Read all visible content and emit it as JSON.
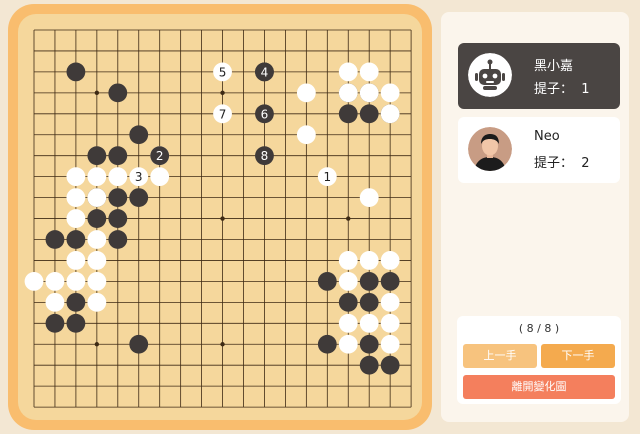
{
  "board": {
    "size": 19,
    "line_color": "#3e2a14",
    "board_color": "#f5d79c",
    "frame_color": "#f9bd6e",
    "black_stone_color": "#3f3a39",
    "white_stone_color": "#ffffff",
    "star_points": [
      [
        3,
        3
      ],
      [
        9,
        3
      ],
      [
        15,
        3
      ],
      [
        3,
        9
      ],
      [
        9,
        9
      ],
      [
        15,
        9
      ],
      [
        3,
        15
      ],
      [
        9,
        15
      ],
      [
        15,
        15
      ]
    ],
    "black_stones": [
      [
        2,
        2
      ],
      [
        4,
        3
      ],
      [
        5,
        5
      ],
      [
        3,
        6
      ],
      [
        4,
        6
      ],
      [
        3,
        8
      ],
      [
        4,
        8
      ],
      [
        5,
        8
      ],
      [
        3,
        9
      ],
      [
        4,
        9
      ],
      [
        1,
        10
      ],
      [
        2,
        10
      ],
      [
        4,
        10
      ],
      [
        2,
        13
      ],
      [
        2,
        14
      ],
      [
        1,
        14
      ],
      [
        5,
        15
      ],
      [
        11,
        2
      ],
      [
        15,
        3
      ],
      [
        16,
        3
      ],
      [
        16,
        4
      ],
      [
        17,
        4
      ],
      [
        15,
        4
      ],
      [
        14,
        12
      ],
      [
        16,
        12
      ],
      [
        17,
        12
      ],
      [
        15,
        13
      ],
      [
        16,
        13
      ],
      [
        14,
        15
      ],
      [
        16,
        15
      ],
      [
        16,
        16
      ],
      [
        17,
        16
      ]
    ],
    "white_stones": [
      [
        2,
        7
      ],
      [
        3,
        7
      ],
      [
        4,
        7
      ],
      [
        6,
        7
      ],
      [
        3,
        8
      ],
      [
        6,
        6
      ],
      [
        2,
        8
      ],
      [
        2,
        9
      ],
      [
        3,
        10
      ],
      [
        2,
        11
      ],
      [
        1,
        12
      ],
      [
        0,
        12
      ],
      [
        3,
        11
      ],
      [
        2,
        12
      ],
      [
        3,
        12
      ],
      [
        1,
        13
      ],
      [
        3,
        13
      ],
      [
        13,
        3
      ],
      [
        15,
        3
      ],
      [
        16,
        3
      ],
      [
        17,
        3
      ],
      [
        17,
        4
      ],
      [
        16,
        2
      ],
      [
        15,
        2
      ],
      [
        13,
        5
      ],
      [
        16,
        8
      ],
      [
        15,
        11
      ],
      [
        16,
        11
      ],
      [
        17,
        11
      ],
      [
        15,
        12
      ],
      [
        17,
        13
      ],
      [
        16,
        14
      ],
      [
        17,
        14
      ],
      [
        15,
        14
      ],
      [
        15,
        15
      ],
      [
        17,
        15
      ]
    ],
    "numbered_moves": [
      {
        "num": "1",
        "color": "white",
        "x": 14,
        "y": 7
      },
      {
        "num": "2",
        "color": "black",
        "x": 6,
        "y": 6
      },
      {
        "num": "3",
        "color": "white",
        "x": 5,
        "y": 7
      },
      {
        "num": "4",
        "color": "black",
        "x": 11,
        "y": 2
      },
      {
        "num": "5",
        "color": "white",
        "x": 9,
        "y": 2
      },
      {
        "num": "6",
        "color": "black",
        "x": 11,
        "y": 4
      },
      {
        "num": "7",
        "color": "white",
        "x": 9,
        "y": 4
      },
      {
        "num": "8",
        "color": "black",
        "x": 11,
        "y": 6
      }
    ]
  },
  "players": {
    "black": {
      "name": "黑小嘉",
      "captures_label": "提子：",
      "captures": "1"
    },
    "white": {
      "name": "Neo",
      "captures_label": "提子：",
      "captures": "2"
    }
  },
  "variation": {
    "progress": "( 8 / 8 )",
    "prev_label": "上一手",
    "next_label": "下一手",
    "exit_label": "離開變化圖"
  }
}
